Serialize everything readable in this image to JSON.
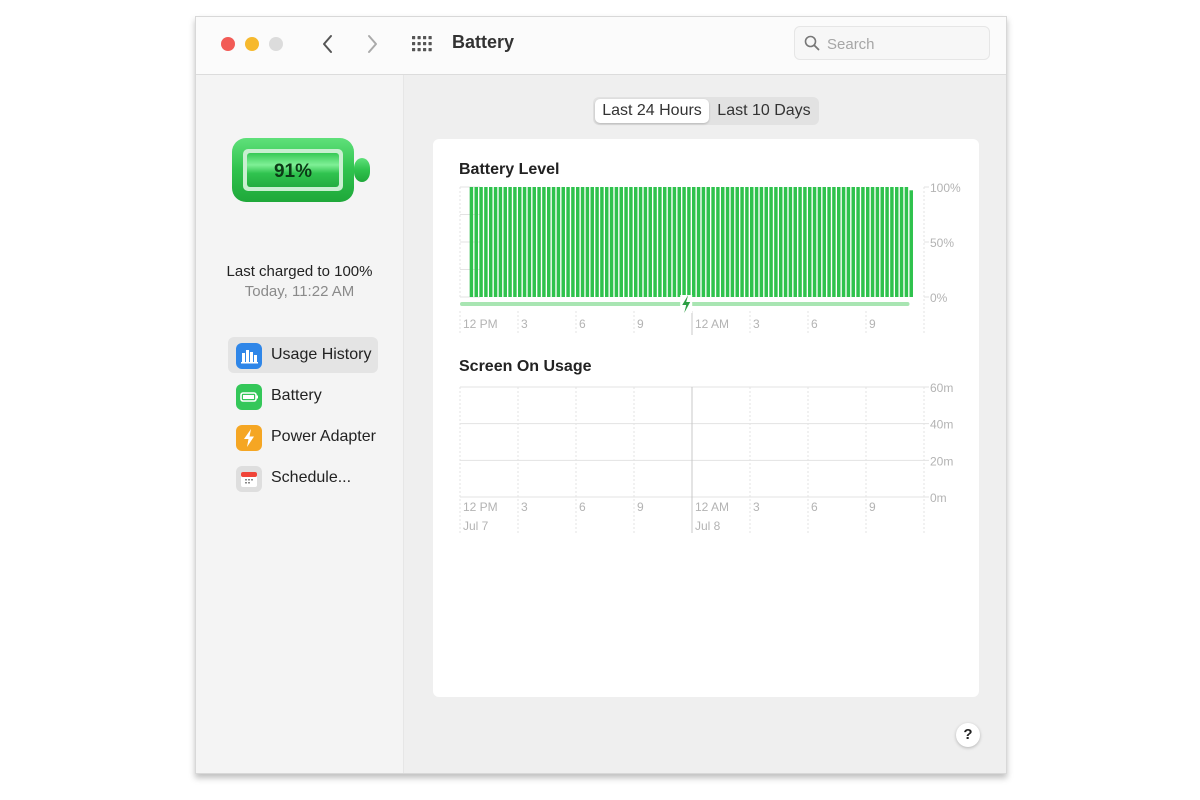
{
  "window": {
    "title": "Battery",
    "search_placeholder": "Search"
  },
  "sidebar": {
    "battery_percent_label": "91%",
    "battery_level": 0.91,
    "last_charged": "Last charged to 100%",
    "last_charged_time": "Today, 11:22 AM",
    "items": [
      {
        "label": "Usage History",
        "icon": "bar-chart-icon",
        "color": "#2f86e8",
        "selected": true
      },
      {
        "label": "Battery",
        "icon": "battery-icon",
        "color": "#34c759",
        "selected": false
      },
      {
        "label": "Power Adapter",
        "icon": "lightning-icon",
        "color": "#f5a623",
        "selected": false
      },
      {
        "label": "Schedule...",
        "icon": "calendar-icon",
        "color": "#dedede",
        "selected": false
      }
    ]
  },
  "segmented": {
    "options": [
      "Last 24 Hours",
      "Last 10 Days"
    ],
    "selected": 0
  },
  "help_label": "?",
  "colors": {
    "battery_green": "#34c759",
    "bar_green": "#2fc24d",
    "charging_line": "#a8e5b2",
    "grid": "#e3e3e3",
    "tick_text": "#b3b3b3"
  },
  "chart_data": [
    {
      "type": "bar",
      "title": "Battery Level",
      "ylabel": "",
      "xlabel": "",
      "ylim": [
        0,
        100
      ],
      "y_ticks": [
        "100%",
        "50%",
        "0%"
      ],
      "x_tick_labels": [
        "12 PM",
        "3",
        "6",
        "9",
        "12 AM",
        "3",
        "6",
        "9"
      ],
      "x_tick_hours": [
        0,
        3,
        6,
        9,
        12,
        15,
        18,
        21
      ],
      "x_range_hours": [
        0,
        24
      ],
      "bar_interval_minutes": 15,
      "first_bar_hour": 0.5,
      "values": [
        100,
        100,
        100,
        100,
        100,
        100,
        100,
        100,
        100,
        100,
        100,
        100,
        100,
        100,
        100,
        100,
        100,
        100,
        100,
        100,
        100,
        100,
        100,
        100,
        100,
        100,
        100,
        100,
        100,
        100,
        100,
        100,
        100,
        100,
        100,
        100,
        100,
        100,
        100,
        100,
        100,
        100,
        100,
        100,
        100,
        100,
        100,
        100,
        100,
        100,
        100,
        100,
        100,
        100,
        100,
        100,
        100,
        100,
        100,
        100,
        100,
        100,
        100,
        100,
        100,
        100,
        100,
        100,
        100,
        100,
        100,
        100,
        100,
        100,
        100,
        100,
        100,
        100,
        100,
        100,
        100,
        100,
        100,
        100,
        100,
        100,
        100,
        100,
        100,
        100,
        100,
        97
      ],
      "charging": {
        "from_hour": 0,
        "to_hour": 23.25,
        "charge_marker_hour": 11.7,
        "label": "charging"
      }
    },
    {
      "type": "bar",
      "title": "Screen On Usage",
      "ylim": [
        0,
        60
      ],
      "y_ticks": [
        "60m",
        "40m",
        "20m",
        "0m"
      ],
      "x_tick_labels": [
        "12 PM",
        "3",
        "6",
        "9",
        "12 AM",
        "3",
        "6",
        "9"
      ],
      "x_tick_hours": [
        0,
        3,
        6,
        9,
        12,
        15,
        18,
        21
      ],
      "date_labels": [
        {
          "hour": 0,
          "label": "Jul 7"
        },
        {
          "hour": 12,
          "label": "Jul 8"
        }
      ],
      "x_range_hours": [
        0,
        24
      ],
      "values": []
    }
  ]
}
